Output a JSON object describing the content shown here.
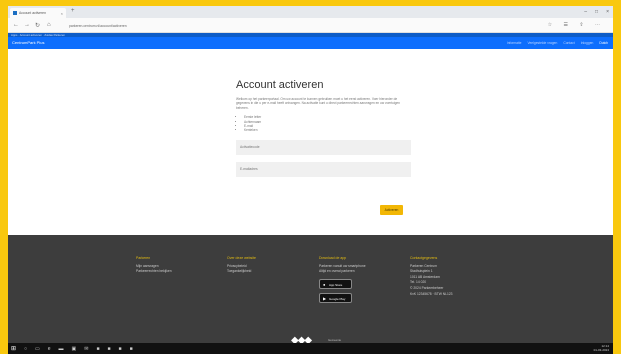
{
  "browser": {
    "tab_title": "Account activeren",
    "url": "parkeren.centrum.nl/account/activeren",
    "favorites_strip": "Apps · Account activeren · Zuidas Parkeren"
  },
  "site": {
    "brand": "CentrumPark Plus",
    "nav": [
      "Informatie",
      "Veelgestelde vragen",
      "Contact",
      "Inloggen",
      "Dutch"
    ]
  },
  "page": {
    "title": "Account activeren",
    "intro": "Welkom op het parkeerportaal. Om uw account te kunnen gebruiken moet u het eerst activeren. Voer hieronder de gegevens in die u per e-mail heeft ontvangen. Na activatie kunt u direct parkeerrechten aanvragen en uw voertuigen beheren.",
    "bullets": [
      "Eerste letter",
      "Achternaam",
      "E-mail",
      "Kenteken"
    ],
    "input1_placeholder": "Activatiecode",
    "input2_placeholder": "E-mailadres",
    "activate_label": "Activeren"
  },
  "footer": {
    "col1": {
      "title": "Parkeren",
      "items": [
        "Mijn aanvragen",
        "Parkeerrechten bekijken"
      ]
    },
    "col2": {
      "title": "Over deze website",
      "items": [
        "Privacybeleid",
        "Toegankelijkheid"
      ]
    },
    "col3": {
      "title": "Download de app",
      "items": [
        "Parkeren vanuit uw smartphone",
        "Altijd en overal parkeren"
      ],
      "app_store": "App Store",
      "google_play": "Google Play"
    },
    "col4": {
      "title": "Contactgegevens",
      "items": [
        "Parkeren Centrum",
        "Stadhuisplein 1",
        "1011 AB Amsterdam",
        "Tel. 14 020",
        "© 2024 Parkeerbeheer",
        "KvK 12345678 · BTW NL123"
      ]
    },
    "logo_text": [
      "Gemeente",
      "Amsterdam"
    ]
  },
  "taskbar": {
    "time": "12:14",
    "date": "01-03-2024"
  }
}
